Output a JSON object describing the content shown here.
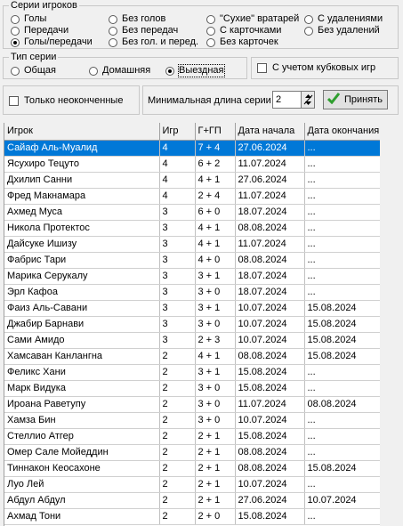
{
  "series_group": {
    "title": "Серии игроков",
    "options": [
      {
        "label": "Голы",
        "selected": false
      },
      {
        "label": "Без голов",
        "selected": false
      },
      {
        "label": "\"Сухие\" вратарей",
        "selected": false
      },
      {
        "label": "С удалениями",
        "selected": false
      },
      {
        "label": "Передачи",
        "selected": false
      },
      {
        "label": "Без передач",
        "selected": false
      },
      {
        "label": "С карточками",
        "selected": false
      },
      {
        "label": "Без удалений",
        "selected": false
      },
      {
        "label": "Голы/передачи",
        "selected": true
      },
      {
        "label": "Без гол. и перед.",
        "selected": false
      },
      {
        "label": "Без карточек",
        "selected": false
      }
    ]
  },
  "type_group": {
    "title": "Тип серии",
    "options": [
      {
        "label": "Общая",
        "selected": false
      },
      {
        "label": "Домашняя",
        "selected": false
      },
      {
        "label": "Выездная",
        "selected": true
      }
    ]
  },
  "cup_games_checkbox": {
    "label": "С учетом кубковых игр",
    "checked": false
  },
  "unfinished_checkbox": {
    "label": "Только неоконченные",
    "checked": false
  },
  "min_length": {
    "label": "Минимальная длина серии",
    "value": "2"
  },
  "apply_button": {
    "label": "Принять"
  },
  "table": {
    "columns": [
      "Игрок",
      "Игр",
      "Г+ГП",
      "Дата начала",
      "Дата окончания"
    ],
    "rows": [
      [
        "Сайаф Аль-Муалид",
        "4",
        "7 + 4",
        "27.06.2024",
        "..."
      ],
      [
        "Ясухиро Тецуто",
        "4",
        "6 + 2",
        "11.07.2024",
        "..."
      ],
      [
        "Дхилип Санни",
        "4",
        "4 + 1",
        "27.06.2024",
        "..."
      ],
      [
        "Фред Макнамара",
        "4",
        "2 + 4",
        "11.07.2024",
        "..."
      ],
      [
        "Ахмед Муса",
        "3",
        "6 + 0",
        "18.07.2024",
        "..."
      ],
      [
        "Никола Протектос",
        "3",
        "4 + 1",
        "08.08.2024",
        "..."
      ],
      [
        "Дайсуке Ишизу",
        "3",
        "4 + 1",
        "11.07.2024",
        "..."
      ],
      [
        "Фабрис Тари",
        "3",
        "4 + 0",
        "08.08.2024",
        "..."
      ],
      [
        "Марика Серукалу",
        "3",
        "3 + 1",
        "18.07.2024",
        "..."
      ],
      [
        "Эрл Кафоа",
        "3",
        "3 + 0",
        "18.07.2024",
        "..."
      ],
      [
        "Фаиз Аль-Савани",
        "3",
        "3 + 1",
        "10.07.2024",
        "15.08.2024"
      ],
      [
        "Джабир Барнави",
        "3",
        "3 + 0",
        "10.07.2024",
        "15.08.2024"
      ],
      [
        "Сами Амидо",
        "3",
        "2 + 3",
        "10.07.2024",
        "15.08.2024"
      ],
      [
        "Хамсаван Канлангна",
        "2",
        "4 + 1",
        "08.08.2024",
        "15.08.2024"
      ],
      [
        "Феликс Хани",
        "2",
        "3 + 1",
        "15.08.2024",
        "..."
      ],
      [
        "Марк Видука",
        "2",
        "3 + 0",
        "15.08.2024",
        "..."
      ],
      [
        "Ироана Раветупу",
        "2",
        "3 + 0",
        "11.07.2024",
        "08.08.2024"
      ],
      [
        "Хамза Бин",
        "2",
        "3 + 0",
        "10.07.2024",
        "..."
      ],
      [
        "Стеллио Атгер",
        "2",
        "2 + 1",
        "15.08.2024",
        "..."
      ],
      [
        "Омер Сале Мойеддин",
        "2",
        "2 + 1",
        "08.08.2024",
        "..."
      ],
      [
        "Тиннакон Кеосахоне",
        "2",
        "2 + 1",
        "08.08.2024",
        "15.08.2024"
      ],
      [
        "Луо Лей",
        "2",
        "2 + 1",
        "10.07.2024",
        "..."
      ],
      [
        "Абдул Абдул",
        "2",
        "2 + 1",
        "27.06.2024",
        "10.07.2024"
      ],
      [
        "Ахмад Тони",
        "2",
        "2 + 0",
        "15.08.2024",
        "..."
      ]
    ],
    "selected_row": 0
  },
  "colors": {
    "selection": "#0078d7",
    "ok_check": "#2e9e2e"
  }
}
